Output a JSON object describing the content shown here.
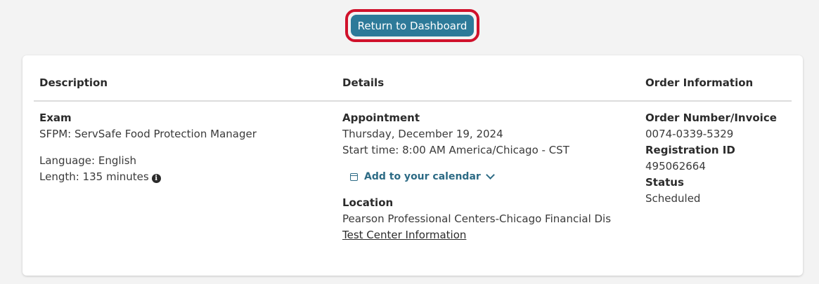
{
  "top": {
    "return_label": "Return to Dashboard"
  },
  "headers": {
    "description": "Description",
    "details": "Details",
    "order": "Order Information"
  },
  "description": {
    "exam_label": "Exam",
    "exam_name": "SFPM: ServSafe Food Protection Manager",
    "language": "Language: English",
    "length": "Length: 135 minutes",
    "info_icon": "info-icon"
  },
  "details": {
    "appointment_label": "Appointment",
    "date": "Thursday, December 19, 2024",
    "start_time": "Start time: 8:00 AM America/Chicago - CST",
    "calendar_label": "Add to your calendar",
    "calendar_icon": "calendar-icon",
    "chevron_icon": "chevron-down-icon",
    "location_label": "Location",
    "location_name": "Pearson Professional Centers-Chicago Financial Dis",
    "test_center_link": "Test Center Information"
  },
  "order": {
    "order_number_label": "Order Number/Invoice",
    "order_number": "0074-0339-5329",
    "registration_label": "Registration ID",
    "registration_id": "495062664",
    "status_label": "Status",
    "status": "Scheduled"
  },
  "colors": {
    "button_bg": "#2d7a99",
    "highlight_border": "#d0112b",
    "link": "#2d6b85",
    "page_bg": "#f3f3f3"
  }
}
